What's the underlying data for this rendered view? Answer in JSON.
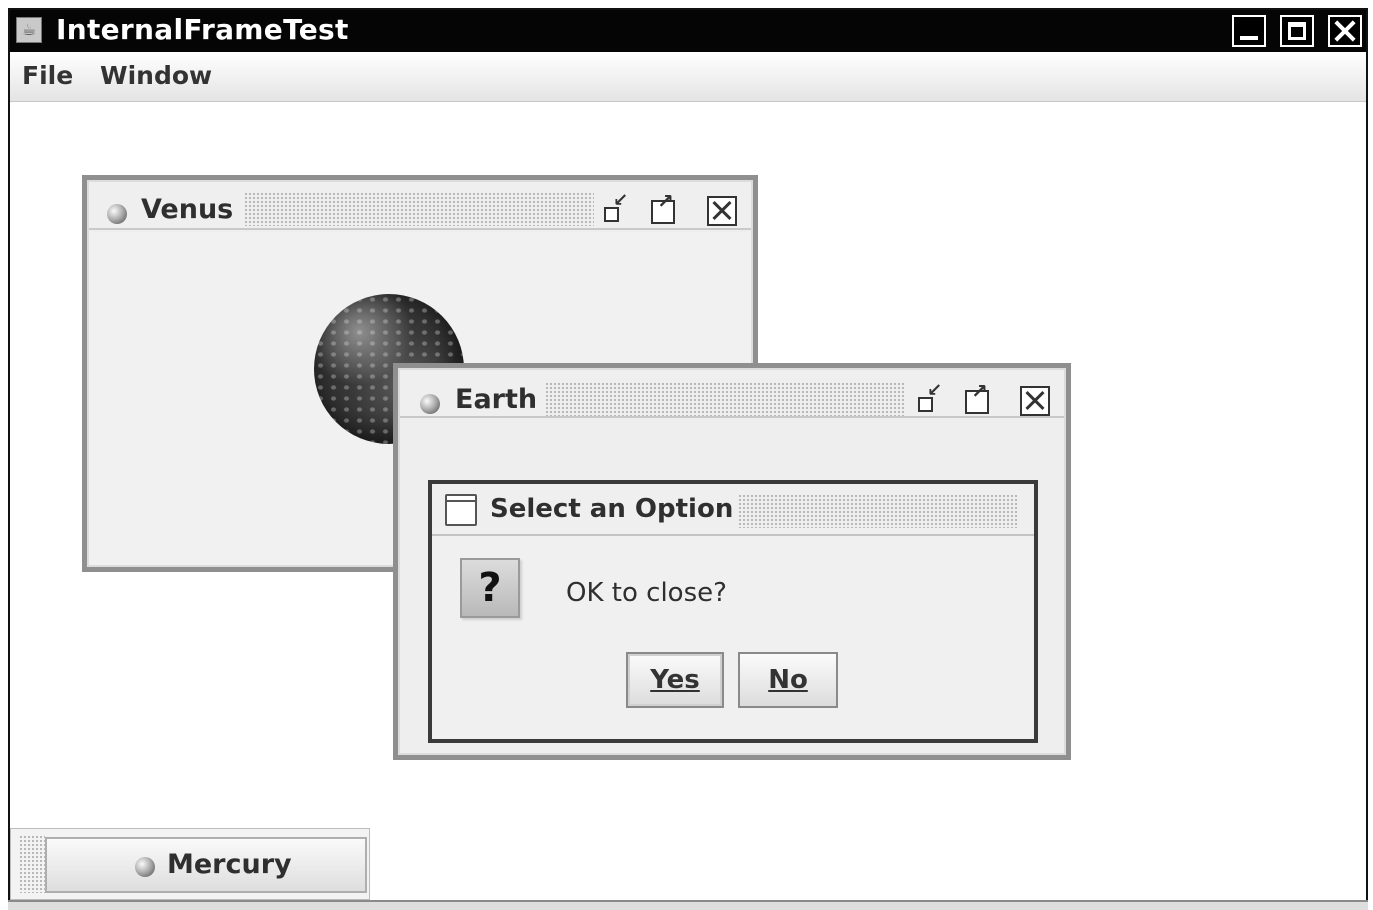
{
  "app": {
    "title": "InternalFrameTest"
  },
  "menu": {
    "items": [
      "File",
      "Window"
    ]
  },
  "frames": {
    "venus": {
      "title": "Venus"
    },
    "earth": {
      "title": "Earth"
    }
  },
  "dialog": {
    "title": "Select an Option",
    "message": "OK to close?",
    "icon": "?",
    "buttons": {
      "yes": "Yes",
      "no": "No"
    }
  },
  "iconified": {
    "mercury": {
      "label": "Mercury"
    }
  },
  "icons": {
    "window_controls": [
      "minimize-icon",
      "maximize-icon",
      "close-icon"
    ],
    "frame_controls": [
      "iconify-icon",
      "maximize-icon",
      "close-icon"
    ],
    "dialog_type": "question-icon"
  }
}
